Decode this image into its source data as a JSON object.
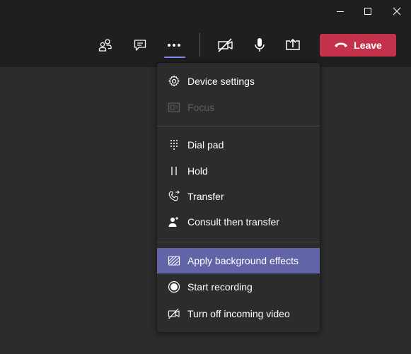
{
  "window": {
    "minimize_icon": "minimize-icon",
    "maximize_icon": "maximize-icon",
    "close_icon": "close-icon"
  },
  "toolbar": {
    "buttons": [
      {
        "icon": "participants-icon"
      },
      {
        "icon": "chat-icon"
      },
      {
        "icon": "more-actions-icon"
      },
      {
        "icon": "camera-off-icon"
      },
      {
        "icon": "microphone-icon"
      },
      {
        "icon": "share-screen-icon"
      }
    ],
    "leave_label": "Leave",
    "leave_color": "#c4314b"
  },
  "menu": {
    "items": [
      {
        "label": "Device settings",
        "icon": "gear-icon",
        "enabled": true
      },
      {
        "label": "Focus",
        "icon": "focus-icon",
        "enabled": false
      },
      {
        "label": "Dial pad",
        "icon": "dial-pad-icon",
        "enabled": true
      },
      {
        "label": "Hold",
        "icon": "hold-icon",
        "enabled": true
      },
      {
        "label": "Transfer",
        "icon": "transfer-icon",
        "enabled": true
      },
      {
        "label": "Consult then transfer",
        "icon": "consult-transfer-icon",
        "enabled": true
      },
      {
        "label": "Apply background effects",
        "icon": "background-effects-icon",
        "enabled": true,
        "highlighted": true
      },
      {
        "label": "Start recording",
        "icon": "record-icon",
        "enabled": true
      },
      {
        "label": "Turn off incoming video",
        "icon": "video-off-icon",
        "enabled": true
      }
    ],
    "highlight_color": "#6264a7"
  }
}
